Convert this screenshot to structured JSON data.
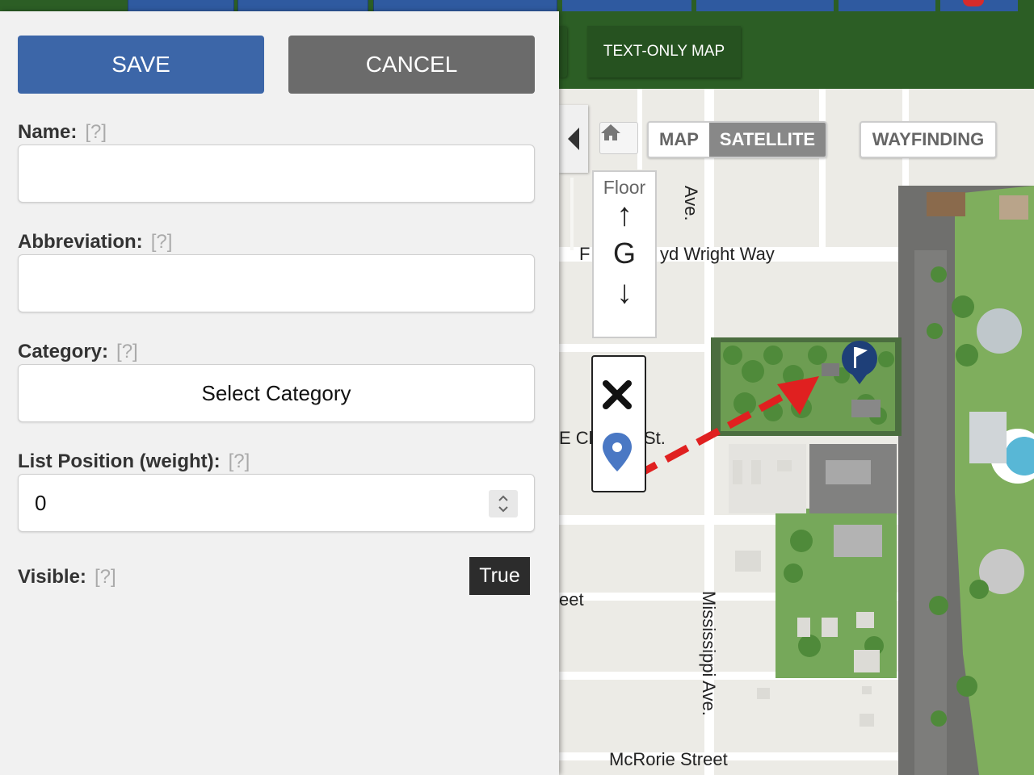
{
  "header": {
    "text_only_map_label": "TEXT-ONLY MAP"
  },
  "form": {
    "save_label": "SAVE",
    "cancel_label": "CANCEL",
    "help_marker": "[?]",
    "name": {
      "label": "Name:",
      "value": ""
    },
    "abbreviation": {
      "label": "Abbreviation:",
      "value": ""
    },
    "category": {
      "label": "Category:",
      "value": "Select Category"
    },
    "list_position": {
      "label": "List Position (weight):",
      "value": "0"
    },
    "visible": {
      "label": "Visible:",
      "value": "True"
    }
  },
  "map": {
    "map_type_options": [
      "MAP",
      "SATELLITE"
    ],
    "selected_map_type": "SATELLITE",
    "wayfinding_label": "WAYFINDING",
    "floor": {
      "label": "Floor",
      "up_arrow": "↑",
      "current": "G",
      "down_arrow": "↓"
    },
    "street_labels": {
      "flw_left": "F",
      "flw_right": "yd Wright Way",
      "mississippi_top": "Ave.",
      "charles_left": "E Ch",
      "charles_right": "St.",
      "street_partial": "eet",
      "mississippi_lower": "Mississippi Ave.",
      "mcrorie": "McRorie Street"
    },
    "colors": {
      "green_header": "#2c5e25",
      "save_blue": "#3c66a8",
      "cancel_gray": "#6b6b6b",
      "arrow_red": "#e02020",
      "pin_blue": "#4a78c4",
      "flag_navy": "#1e3f78"
    },
    "icons": [
      "home-icon",
      "close-icon",
      "location-pin-icon",
      "flag-marker-icon",
      "direction-arrow"
    ]
  }
}
